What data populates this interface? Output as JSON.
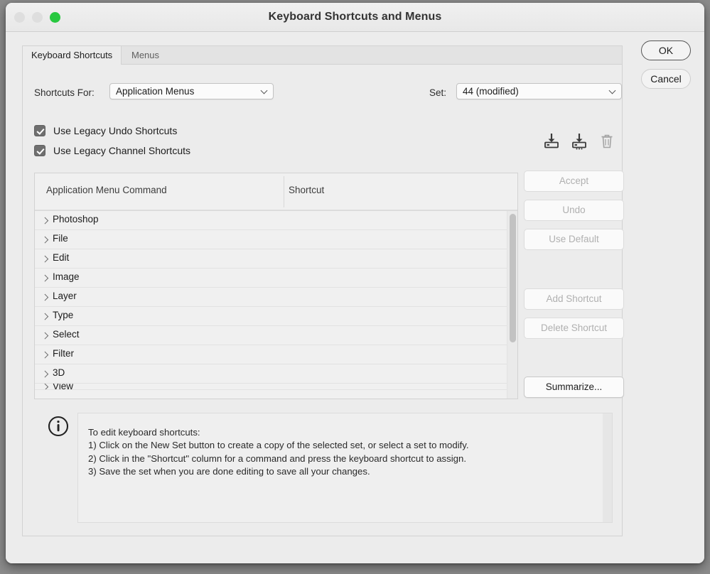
{
  "window": {
    "title": "Keyboard Shortcuts and Menus",
    "traffic": {
      "close_label": "close-window",
      "minimize_label": "minimize-window",
      "maximize_label": "maximize-window"
    }
  },
  "top_buttons": {
    "ok": "OK",
    "cancel": "Cancel"
  },
  "tabs": [
    {
      "label": "Keyboard Shortcuts",
      "active": true
    },
    {
      "label": "Menus",
      "active": false
    }
  ],
  "fields": {
    "shortcuts_for_label": "Shortcuts For:",
    "shortcuts_for_value": "Application Menus",
    "set_label": "Set:",
    "set_value": "44 (modified)"
  },
  "checkboxes": [
    {
      "label": "Use Legacy Undo Shortcuts",
      "checked": true
    },
    {
      "label": "Use Legacy Channel Shortcuts",
      "checked": true
    }
  ],
  "icon_tools": [
    {
      "name": "save-set-icon",
      "enabled": true
    },
    {
      "name": "save-set-as-icon",
      "enabled": true
    },
    {
      "name": "delete-set-icon",
      "enabled": false
    }
  ],
  "table": {
    "headers": [
      "Application Menu Command",
      "Shortcut"
    ],
    "rows": [
      {
        "command": "Photoshop",
        "shortcut": ""
      },
      {
        "command": "File",
        "shortcut": ""
      },
      {
        "command": "Edit",
        "shortcut": ""
      },
      {
        "command": "Image",
        "shortcut": ""
      },
      {
        "command": "Layer",
        "shortcut": ""
      },
      {
        "command": "Type",
        "shortcut": ""
      },
      {
        "command": "Select",
        "shortcut": ""
      },
      {
        "command": "Filter",
        "shortcut": ""
      },
      {
        "command": "3D",
        "shortcut": ""
      },
      {
        "command": "View",
        "shortcut": ""
      }
    ]
  },
  "side_buttons": [
    {
      "label": "Accept",
      "enabled": false
    },
    {
      "label": "Undo",
      "enabled": false
    },
    {
      "label": "Use Default",
      "enabled": false
    },
    {
      "label": "Add Shortcut",
      "enabled": false
    },
    {
      "label": "Delete Shortcut",
      "enabled": false
    },
    {
      "label": "Summarize...",
      "enabled": true
    }
  ],
  "info": {
    "icon": "info-circle-icon",
    "lines": [
      "To edit keyboard shortcuts:",
      "1) Click on the New Set button to create a copy of the selected set, or select a set to modify.",
      "2) Click in the \"Shortcut\" column for a command and press the keyboard shortcut to assign.",
      "3) Save the set when you are done editing to save all your changes."
    ]
  }
}
